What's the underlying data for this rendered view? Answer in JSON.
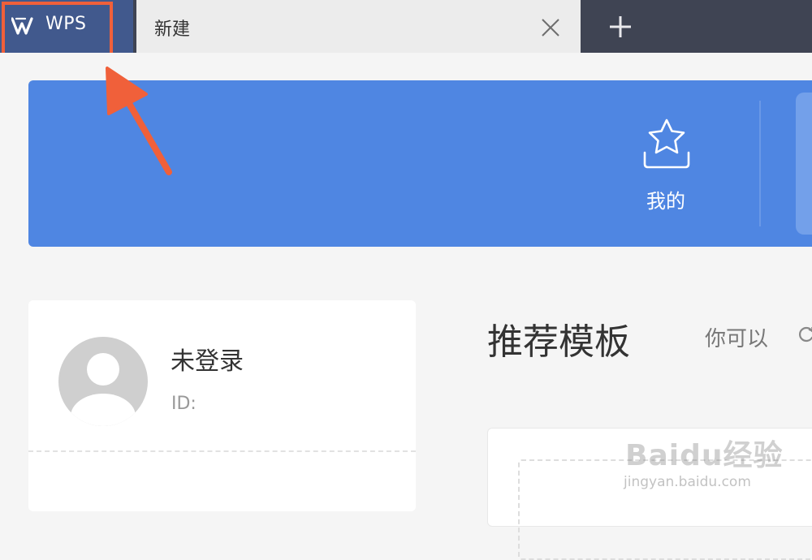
{
  "titlebar": {
    "app_button_label": "WPS",
    "tab": {
      "title": "新建"
    },
    "new_tab_label": "+"
  },
  "banner": {
    "mine_label": "我的"
  },
  "user_card": {
    "username": "未登录",
    "id_label": "ID:"
  },
  "templates": {
    "title": "推荐模板",
    "subtitle": "你可以"
  },
  "watermark": {
    "logo_text": "Baidu经验",
    "url": "jingyan.baidu.com"
  },
  "colors": {
    "titlebar_bg": "#3f4453",
    "wps_button_bg": "#41598d",
    "banner_bg": "#4f86e2",
    "annotation": "#f0603a",
    "page_bg": "#f5f5f5"
  },
  "icons": {
    "app_logo": "wps-logo-icon",
    "tab_close": "close-icon",
    "new_tab": "plus-icon",
    "mine": "star-tray-icon",
    "avatar": "user-avatar-icon",
    "refresh": "refresh-icon"
  }
}
